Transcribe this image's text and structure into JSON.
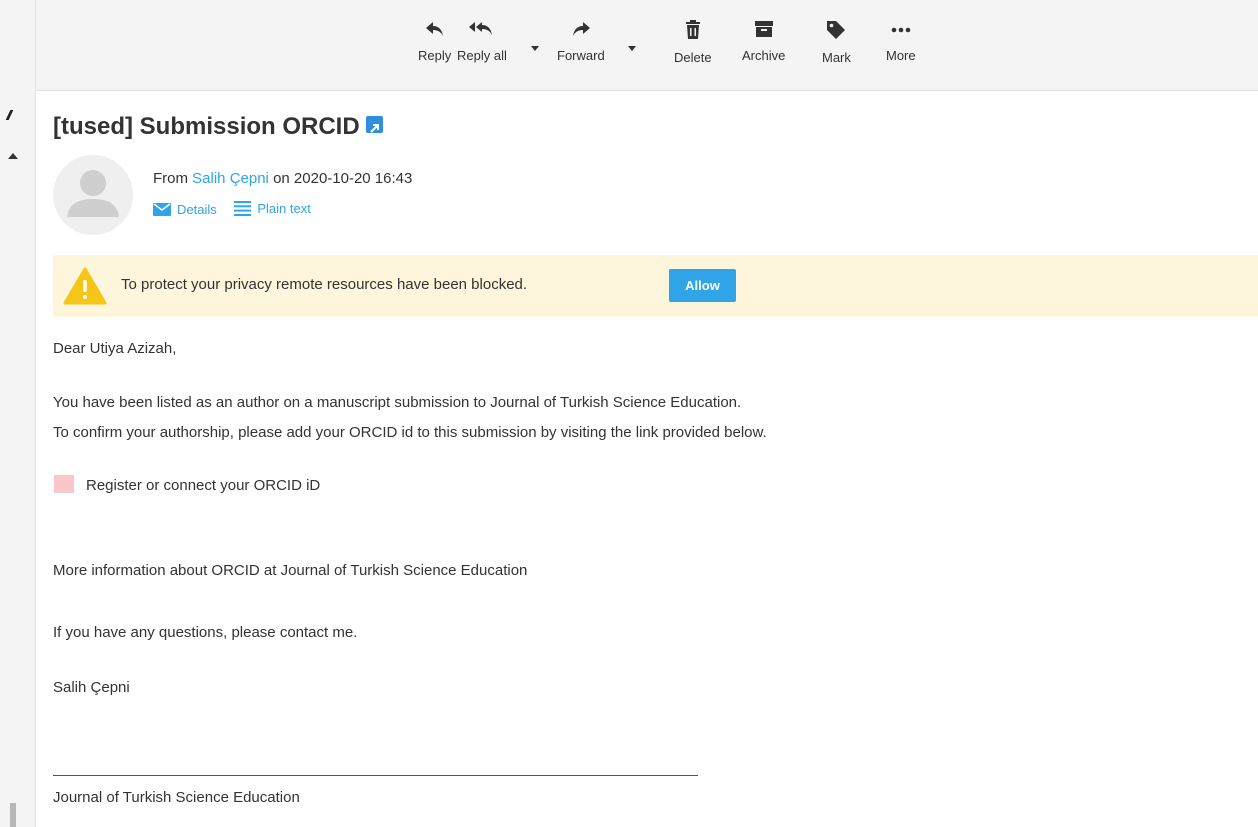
{
  "toolbar": {
    "reply": {
      "label": "Reply",
      "icon": "reply-icon"
    },
    "reply_all": {
      "label": "Reply all",
      "icon": "reply-all-icon"
    },
    "forward": {
      "label": "Forward",
      "icon": "forward-icon"
    },
    "delete": {
      "label": "Delete",
      "icon": "trash-icon"
    },
    "archive": {
      "label": "Archive",
      "icon": "archive-icon"
    },
    "mark": {
      "label": "Mark",
      "icon": "tag-icon"
    },
    "more": {
      "label": "More",
      "icon": "more-icon"
    }
  },
  "message": {
    "subject": "[tused] Submission ORCID",
    "from_prefix": "From",
    "sender": "Salih Çepni",
    "date_text": "on 2020-10-20 16:43",
    "details_label": "Details",
    "plain_text_label": "Plain text"
  },
  "notice": {
    "text": "To protect your privacy remote resources have been blocked.",
    "allow_label": "Allow"
  },
  "body": {
    "greeting": "Dear Utiya Azizah,",
    "para1_line1": "You have been listed as an author on a manuscript submission to Journal of Turkish Science Education.",
    "para1_line2": "To confirm your authorship, please add your ORCID id to this submission by visiting the link provided below.",
    "orcid_link": "Register or connect your ORCID iD",
    "more_info_link": "More information about ORCID at Journal of Turkish Science Education",
    "questions": "If you have any questions, please contact me.",
    "signature": "Salih Çepni",
    "footer_link": "Journal of Turkish Science Education"
  },
  "colors": {
    "accent": "#2fa4e7",
    "notice_bg": "#fdf5dc",
    "warning": "#f5c518",
    "toolbar_bg": "#f4f4f4"
  }
}
